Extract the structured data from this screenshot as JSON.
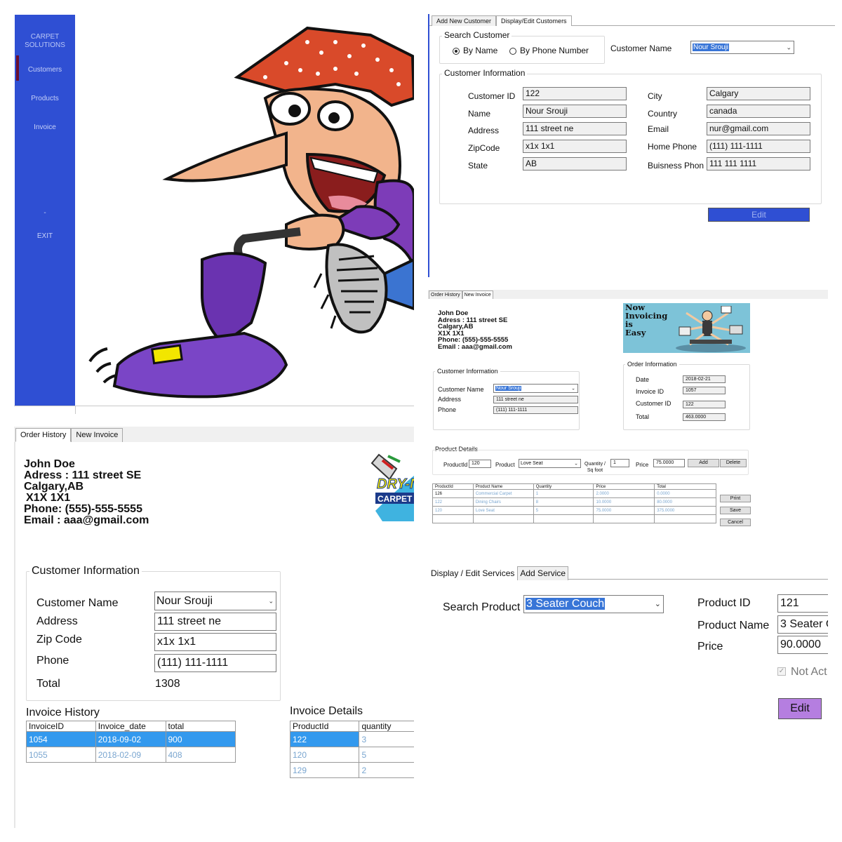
{
  "sidebar": {
    "brand_line1": "CARPET",
    "brand_line2": "SOLUTIONS",
    "items": [
      {
        "label": "Customers"
      },
      {
        "label": "Products"
      },
      {
        "label": "Invoice"
      },
      {
        "label": "-"
      },
      {
        "label": "EXIT"
      }
    ],
    "active_color": "#6b0f2f",
    "bg_color": "#2f4fd3"
  },
  "customers": {
    "tabs": [
      {
        "label": "Add New Customer"
      },
      {
        "label": "Display/Edit Customers"
      }
    ],
    "search": {
      "title": "Search Customer",
      "by_name": "By Name",
      "by_phone": "By Phone Number",
      "selected": "By Name",
      "customer_name_label": "Customer Name",
      "customer_name_value": "Nour Srouji"
    },
    "info": {
      "title": "Customer Information",
      "customer_id_label": "Customer ID",
      "customer_id": "122",
      "name_label": "Name",
      "name": "Nour Srouji",
      "address_label": "Address",
      "address": "111 street ne",
      "zip_label": "ZipCode",
      "zip": "x1x 1x1",
      "state_label": "State",
      "state": "AB",
      "city_label": "City",
      "city": "Calgary",
      "country_label": "Country",
      "country": "canada",
      "email_label": "Email",
      "email": "nur@gmail.com",
      "home_phone_label": "Home Phone",
      "home_phone": "(111) 111-1111",
      "business_phone_label": "Buisness Phon",
      "business_phone": "111 111 1111"
    },
    "edit_label": "Edit",
    "edit_color": "#2f4fd3"
  },
  "order_history": {
    "tabs": [
      {
        "label": "Order History"
      },
      {
        "label": "New Invoice"
      }
    ],
    "company": {
      "name": "John Doe",
      "address": "Adress : 111 street SE",
      "city": "Calgary,AB",
      "postal": "X1X 1X1",
      "phone": "Phone: (555)-555-5555",
      "email": "Email : aaa@gmail.com"
    },
    "logo_text_1": "DRY-N",
    "logo_text_2": "CARPET",
    "info": {
      "title": "Customer Information",
      "customer_name_label": "Customer Name",
      "customer_name": "Nour Srouji",
      "address_label": "Address",
      "address": "111 street ne",
      "zip_label": "Zip Code",
      "zip": "x1x 1x1",
      "phone_label": "Phone",
      "phone": "(111) 111-1111",
      "total_label": "Total",
      "total": "1308"
    },
    "invoice_history": {
      "title": "Invoice History",
      "columns": [
        "InvoiceID",
        "Invoice_date",
        "total"
      ],
      "rows": [
        [
          "1054",
          "2018-09-02",
          "900"
        ],
        [
          "1055",
          "2018-02-09",
          "408"
        ]
      ],
      "selected_row": 0
    },
    "invoice_details": {
      "title": "Invoice Details",
      "columns": [
        "ProductId",
        "quantity"
      ],
      "rows": [
        [
          "122",
          "3"
        ],
        [
          "120",
          "5"
        ],
        [
          "129",
          "2"
        ]
      ],
      "selected_row": 0
    }
  },
  "new_invoice": {
    "tabs": [
      {
        "label": "Order History"
      },
      {
        "label": "New Invoice"
      }
    ],
    "company": {
      "name": "John Doe",
      "address": "Adress : 111 street SE",
      "city": "Calgary,AB",
      "postal": "X1X 1X1",
      "phone": "Phone: (555)-555-5555",
      "email": "Email : aaa@gmail.com"
    },
    "banner_lines": [
      "Now",
      "Invoicing",
      "is",
      "Easy"
    ],
    "customer_info": {
      "title": "Customer Information",
      "customer_name_label": "Customer Name",
      "customer_name": "Nour Srouji",
      "address_label": "Address",
      "address": "111 street ne",
      "phone_label": "Phone",
      "phone": "(111) 111-1111"
    },
    "order_info": {
      "title": "Order Information",
      "date_label": "Date",
      "date": "2018-02-21",
      "invoice_id_label": "Invoice ID",
      "invoice_id": "1057",
      "customer_id_label": "Customer ID",
      "customer_id": "122",
      "total_label": "Total",
      "total": "463.0000"
    },
    "product_details": {
      "title": "Product Details",
      "productid_label": "ProductId",
      "productid": "120",
      "product_label": "Product",
      "product": "Love Seat",
      "quantity_label_1": "Quantity /",
      "quantity_label_2": "Sq foot",
      "quantity": "1",
      "price_label": "Price",
      "price": "75.0000",
      "add_label": "Add",
      "delete_label": "Delete"
    },
    "grid": {
      "columns": [
        "ProductId",
        "Product Name",
        "Quantity",
        "Price",
        "Total"
      ],
      "rows": [
        [
          "126",
          "Commercial Carpet",
          "1",
          "2.0000",
          "0.0000"
        ],
        [
          "122",
          "Dining Chairs",
          "8",
          "10.0000",
          "80.0000"
        ],
        [
          "120",
          "Love Seat",
          "5",
          "75.0000",
          "375.0000"
        ],
        [
          "",
          "",
          "",
          "",
          ""
        ]
      ]
    },
    "print_label": "Print",
    "save_label": "Save",
    "cancel_label": "Cancel"
  },
  "services": {
    "tabs": [
      {
        "label": "Display / Edit Services"
      },
      {
        "label": "Add Service"
      }
    ],
    "search_label": "Search Product",
    "search_value": "3 Seater Couch",
    "product_id_label": "Product ID",
    "product_id": "121",
    "product_name_label": "Product Name",
    "product_name": "3 Seater C",
    "price_label": "Price",
    "price": "90.0000",
    "not_active_label": "Not Act",
    "edit_label": "Edit",
    "edit_color": "#b57ee0"
  }
}
